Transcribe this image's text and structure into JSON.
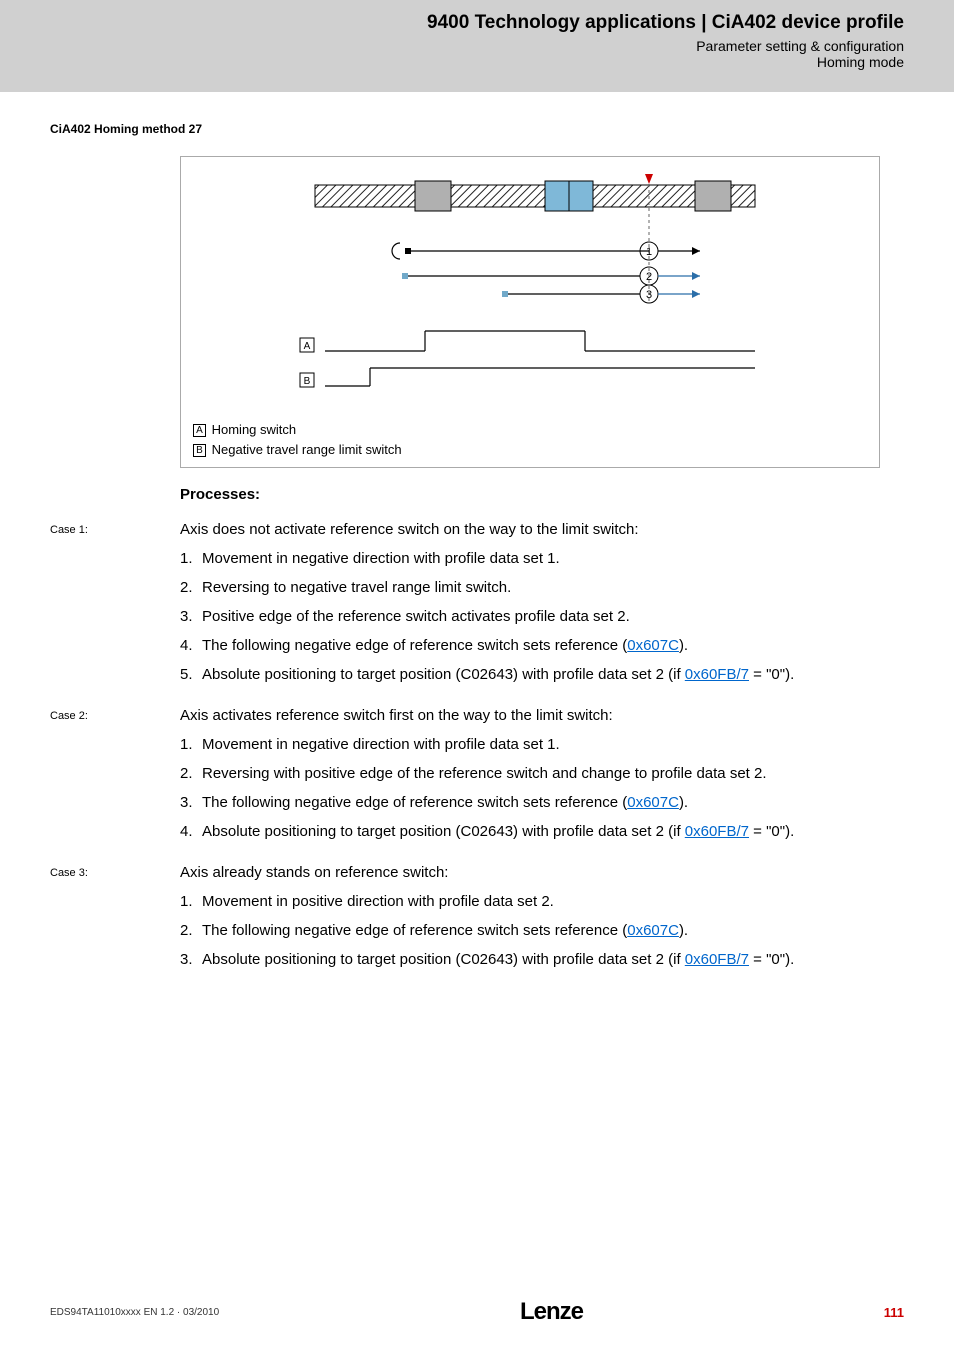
{
  "header": {
    "title": "9400 Technology applications | CiA402 device profile",
    "sub1": "Parameter setting & configuration",
    "sub2": "Homing mode"
  },
  "section_heading": "CiA402 Homing method 27",
  "diagram": {
    "legendA_label": "A",
    "legendA_text": " Homing switch",
    "legendB_label": "B",
    "legendB_text": " Negative travel range limit switch",
    "boxA_label": "A",
    "boxB_label": "B",
    "circle1": "1",
    "circle2": "2",
    "circle3": "3"
  },
  "processes_heading": "Processes:",
  "cases": [
    {
      "label": "Case 1:",
      "intro": "Axis does not activate reference switch on the way to the limit switch:",
      "items": [
        {
          "text": "Movement in negative direction with profile data set 1."
        },
        {
          "text": "Reversing to negative travel range limit switch."
        },
        {
          "text": "Positive edge of the reference switch activates profile data set 2."
        },
        {
          "prefix": "The following negative edge of reference switch sets reference (",
          "link": "0x607C",
          "suffix": ")."
        },
        {
          "prefix": "Absolute positioning to target position (C02643) with profile data set 2 (if ",
          "link": "0x60FB/7",
          "suffix": " = \"0\")."
        }
      ]
    },
    {
      "label": "Case 2:",
      "intro": "Axis activates reference switch first on the way to the limit switch:",
      "items": [
        {
          "text": "Movement in negative direction with profile data set 1."
        },
        {
          "text": "Reversing with positive edge of the reference switch and change to profile data set 2."
        },
        {
          "prefix": "The following negative edge of reference switch sets reference (",
          "link": "0x607C",
          "suffix": ")."
        },
        {
          "prefix": "Absolute positioning to target position (C02643) with profile data set 2 (if ",
          "link": "0x60FB/7",
          "suffix": " = \"0\")."
        }
      ]
    },
    {
      "label": "Case 3:",
      "intro": "Axis already stands on reference switch:",
      "items": [
        {
          "text": "Movement in positive direction with profile data set 2."
        },
        {
          "prefix": "The following negative edge of reference switch sets reference (",
          "link": "0x607C",
          "suffix": ")."
        },
        {
          "prefix": "Absolute positioning to target position (C02643) with profile data set 2 (if ",
          "link": "0x60FB/7",
          "suffix": " = \"0\")."
        }
      ]
    }
  ],
  "footer": {
    "left": "EDS94TA11010xxxx EN 1.2 · 03/2010",
    "logo": "Lenze",
    "page": "111"
  }
}
